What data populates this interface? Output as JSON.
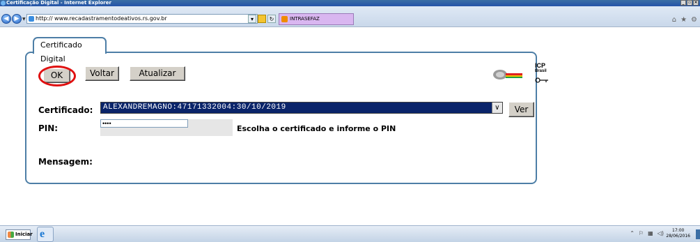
{
  "window": {
    "title": "Certificação Digital - Internet Explorer"
  },
  "browser": {
    "url": "http:// www.recadastramentodeativos.rs.gov.br",
    "tab_title": "INTRASEFAZ"
  },
  "panel": {
    "tab_label": "Certificado Digital",
    "buttons": {
      "ok": "OK",
      "voltar": "Voltar",
      "atualizar": "Atualizar",
      "ver": "Ver"
    },
    "logo_icp_line1": "ICP",
    "logo_icp_line2": "Brasil",
    "labels": {
      "certificado": "Certificado:",
      "pin": "PIN:",
      "mensagem": "Mensagem:"
    },
    "certificado_value": "ALEXANDREMAGNO:47171332004:30/10/2019",
    "pin_value": "••••",
    "pin_hint": "Escolha o certificado e informe o PIN"
  },
  "taskbar": {
    "start_label": "Iniciar",
    "time": "17:00",
    "date": "28/06/2016"
  }
}
